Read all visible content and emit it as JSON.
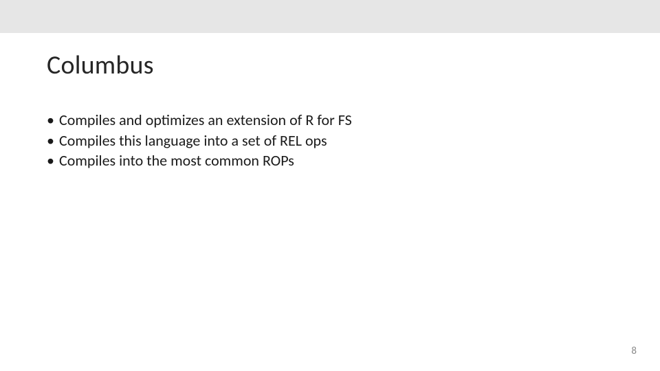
{
  "slide": {
    "title": "Columbus",
    "bullets": [
      "Compiles and optimizes an extension of R for FS",
      "Compiles this language into a set of REL ops",
      "Compiles into the most common ROPs"
    ],
    "page_number": "8"
  }
}
